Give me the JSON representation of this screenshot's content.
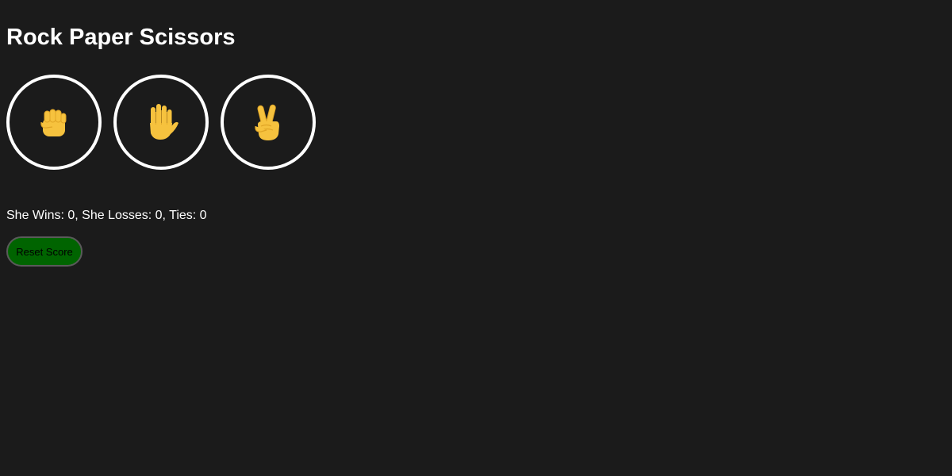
{
  "game": {
    "title": "Rock Paper Scissors"
  },
  "moves": [
    {
      "name": "rock",
      "icon": "raised-fist-icon"
    },
    {
      "name": "paper",
      "icon": "raised-hand-icon"
    },
    {
      "name": "scissors",
      "icon": "victory-hand-icon"
    }
  ],
  "score": {
    "text": "She Wins: 0, She Losses: 0, Ties: 0",
    "wins": 0,
    "losses": 0,
    "ties": 0
  },
  "controls": {
    "reset_label": "Reset Score"
  },
  "colors": {
    "background": "#1b1b1b",
    "text": "#ffffff",
    "circle_border": "#ffffff",
    "icon_fill": "#f6c23e",
    "icon_shadow": "#e0a526",
    "reset_button_bg": "#006400"
  }
}
